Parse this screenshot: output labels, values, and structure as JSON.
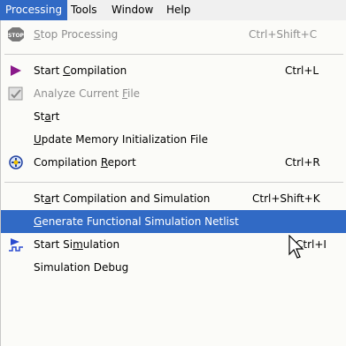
{
  "menubar": {
    "items": [
      {
        "label": "Processing"
      },
      {
        "label": "Tools"
      },
      {
        "label": "Window"
      },
      {
        "label": "Help"
      }
    ],
    "active_color": "#316ac5"
  },
  "dropdown": {
    "items": [
      {
        "pre": "",
        "mn": "S",
        "post": "top Processing",
        "shortcut": "Ctrl+Shift+C",
        "icon": "stop-icon",
        "disabled": true
      },
      {
        "pre": "Start ",
        "mn": "C",
        "post": "ompilation",
        "shortcut": "Ctrl+L",
        "icon": "play-arrow-icon"
      },
      {
        "pre": "Analyze Current ",
        "mn": "F",
        "post": "ile",
        "shortcut": "",
        "icon": "analyze-file-icon",
        "disabled": true
      },
      {
        "pre": "St",
        "mn": "a",
        "post": "rt",
        "shortcut": ""
      },
      {
        "pre": "",
        "mn": "U",
        "post": "pdate Memory Initialization File",
        "shortcut": ""
      },
      {
        "pre": "Compilation ",
        "mn": "R",
        "post": "eport",
        "shortcut": "Ctrl+R",
        "icon": "compilation-report-icon"
      },
      {
        "pre": "St",
        "mn": "a",
        "post": "rt Compilation and Simulation",
        "shortcut": "Ctrl+Shift+K"
      },
      {
        "pre": "",
        "mn": "G",
        "post": "enerate Functional Simulation Netlist",
        "shortcut": "",
        "highlighted": true
      },
      {
        "pre": "Start Si",
        "mn": "m",
        "post": "ulation",
        "shortcut": "Ctrl+I",
        "icon": "simulation-waveform-icon"
      },
      {
        "pre": "Simulation Debug",
        "mn": "",
        "post": "",
        "shortcut": ""
      }
    ]
  },
  "colors": {
    "highlight": "#316ac5",
    "disabled_text": "#8e8e8e"
  }
}
